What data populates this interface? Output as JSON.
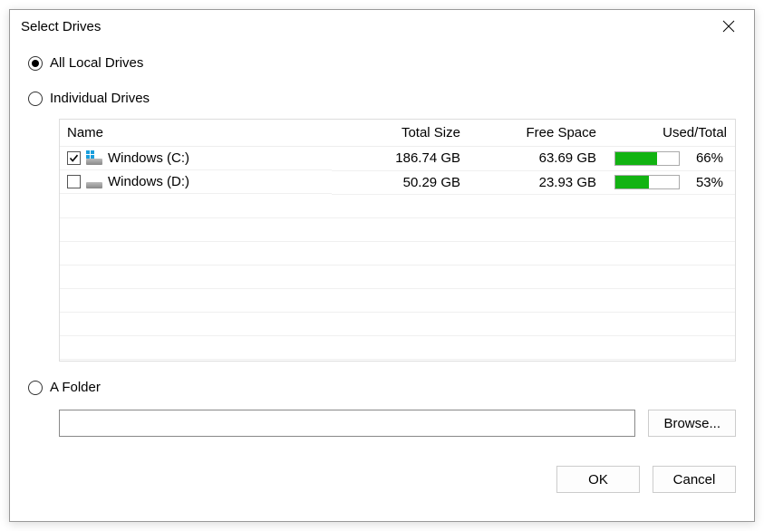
{
  "title": "Select Drives",
  "options": {
    "all_local": {
      "label": "All Local Drives",
      "selected": true
    },
    "individual": {
      "label": "Individual Drives",
      "selected": false
    },
    "a_folder": {
      "label": "A Folder",
      "selected": false
    }
  },
  "table": {
    "headers": {
      "name": "Name",
      "total": "Total Size",
      "free": "Free Space",
      "used": "Used/Total"
    },
    "rows": [
      {
        "checked": true,
        "showWinLogo": true,
        "name": "Windows (C:)",
        "total": "186.74 GB",
        "free": "63.69 GB",
        "pct": 66,
        "pct_label": "66%"
      },
      {
        "checked": false,
        "showWinLogo": false,
        "name": "Windows (D:)",
        "total": "50.29 GB",
        "free": "23.93 GB",
        "pct": 53,
        "pct_label": "53%"
      }
    ],
    "blank_rows": 7
  },
  "folder_path": "",
  "buttons": {
    "browse": "Browse...",
    "ok": "OK",
    "cancel": "Cancel"
  }
}
